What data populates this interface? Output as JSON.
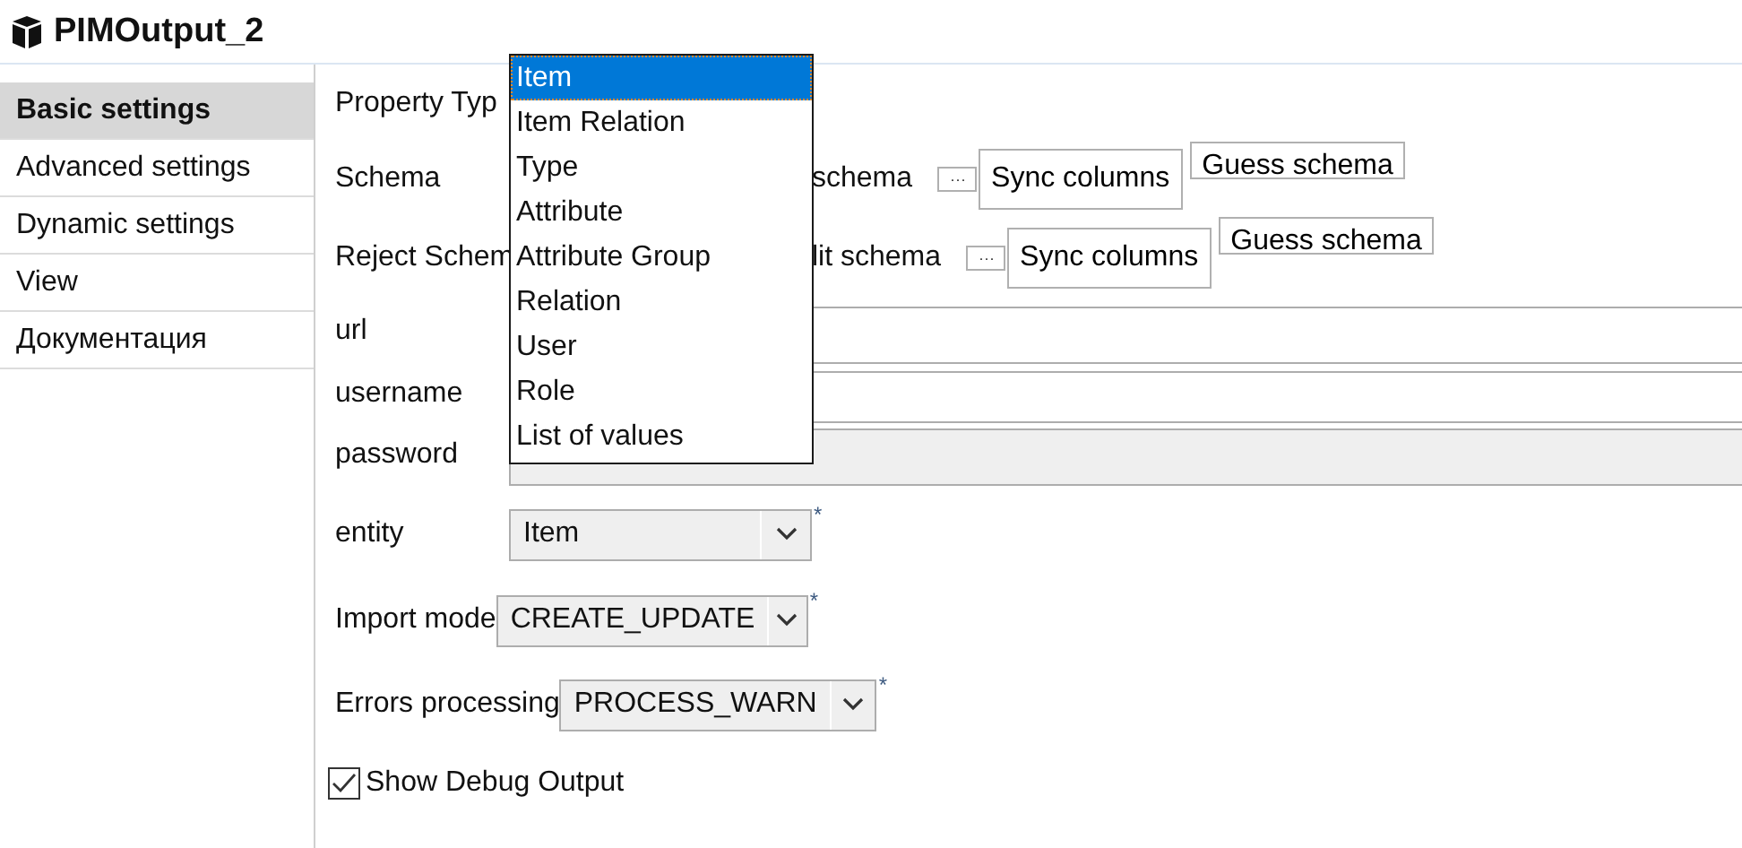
{
  "window": {
    "title": "PIMOutput_2"
  },
  "sidebar": {
    "items": [
      {
        "label": "Basic settings",
        "selected": true
      },
      {
        "label": "Advanced settings",
        "selected": false
      },
      {
        "label": "Dynamic settings",
        "selected": false
      },
      {
        "label": "View",
        "selected": false
      },
      {
        "label": "Документация",
        "selected": false
      }
    ]
  },
  "form": {
    "property_type": {
      "label": "Property Typ"
    },
    "schema_rows": [
      {
        "label": "Schema",
        "edit_label": "schema",
        "browse_button": "···",
        "buttons": [
          "Sync columns",
          "Guess schema"
        ]
      },
      {
        "label": "Reject Schem",
        "edit_label": "lit schema",
        "browse_button": "···",
        "buttons": [
          "Sync columns",
          "Guess schema"
        ]
      }
    ],
    "fields": [
      {
        "label": "url",
        "disabled": false
      },
      {
        "label": "username",
        "disabled": false
      },
      {
        "label": "password",
        "disabled": true
      }
    ],
    "combos": [
      {
        "label": "entity",
        "value": "Item",
        "marker": "*"
      },
      {
        "label": "Import mode",
        "value": "CREATE_UPDATE",
        "marker": "*"
      },
      {
        "label": "Errors processing",
        "value": "PROCESS_WARN",
        "marker": "*"
      }
    ],
    "checkbox": {
      "label": "Show Debug Output",
      "checked": true
    }
  },
  "dropdown": {
    "options": [
      {
        "label": "Item",
        "selected": true
      },
      {
        "label": "Item Relation",
        "selected": false
      },
      {
        "label": "Type",
        "selected": false
      },
      {
        "label": "Attribute",
        "selected": false
      },
      {
        "label": "Attribute Group",
        "selected": false
      },
      {
        "label": "Relation",
        "selected": false
      },
      {
        "label": "User",
        "selected": false
      },
      {
        "label": "Role",
        "selected": false
      },
      {
        "label": "List of values",
        "selected": false
      }
    ]
  }
}
